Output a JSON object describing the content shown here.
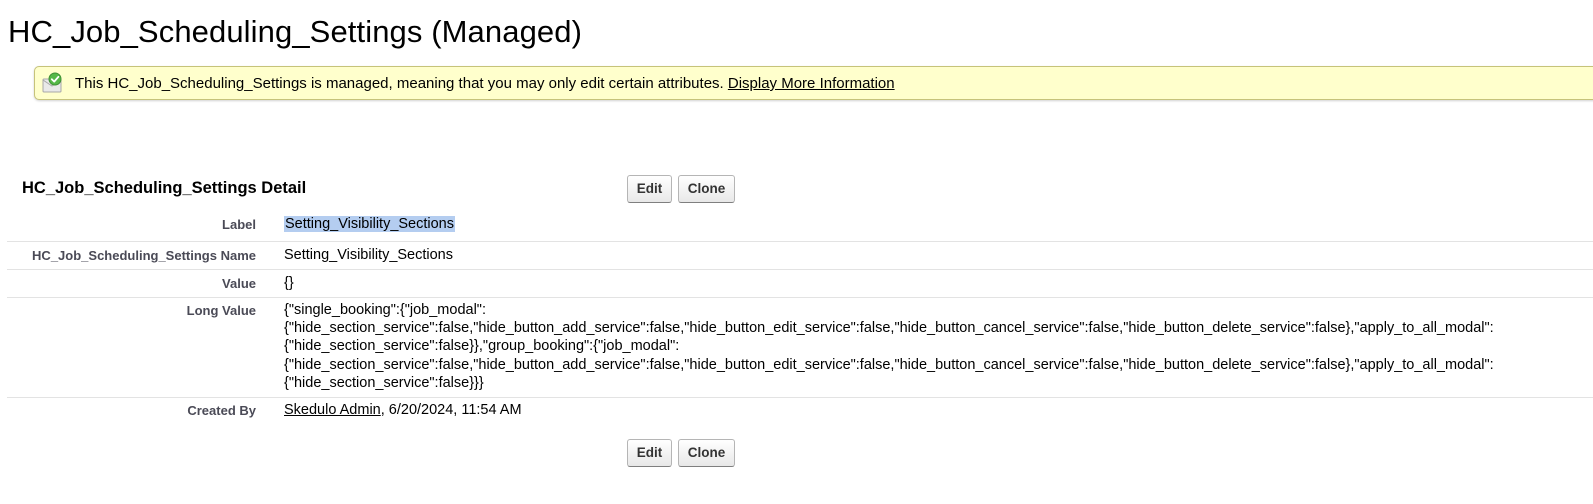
{
  "page": {
    "title": "HC_Job_Scheduling_Settings (Managed)"
  },
  "banner": {
    "message": "This HC_Job_Scheduling_Settings is managed, meaning that you may only edit certain attributes.",
    "link_label": "Display More Information",
    "icon": "managed-checkmark-icon"
  },
  "detail": {
    "section_title": "HC_Job_Scheduling_Settings Detail",
    "edit_label": "Edit",
    "clone_label": "Clone",
    "fields": {
      "label": {
        "label": "Label",
        "value": "Setting_Visibility_Sections"
      },
      "name": {
        "label": "HC_Job_Scheduling_Settings Name",
        "value": "Setting_Visibility_Sections"
      },
      "value": {
        "label": "Value",
        "value": "{}"
      },
      "long_value": {
        "label": "Long Value",
        "lines": [
          "{\"single_booking\":{\"job_modal\":",
          "{\"hide_section_service\":false,\"hide_button_add_service\":false,\"hide_button_edit_service\":false,\"hide_button_cancel_service\":false,\"hide_button_delete_service\":false},\"apply_to_all_modal\":",
          "{\"hide_section_service\":false}},\"group_booking\":{\"job_modal\":",
          "{\"hide_section_service\":false,\"hide_button_add_service\":false,\"hide_button_edit_service\":false,\"hide_button_cancel_service\":false,\"hide_button_delete_service\":false},\"apply_to_all_modal\":",
          "{\"hide_section_service\":false}}}"
        ]
      },
      "created_by": {
        "label": "Created By",
        "user": "Skedulo Admin",
        "timestamp": ", 6/20/2024, 11:54 AM"
      }
    }
  },
  "colors": {
    "banner_background": "#ffffcc",
    "selection_highlight": "#b4cdf0",
    "label_text": "#4a4a56"
  }
}
